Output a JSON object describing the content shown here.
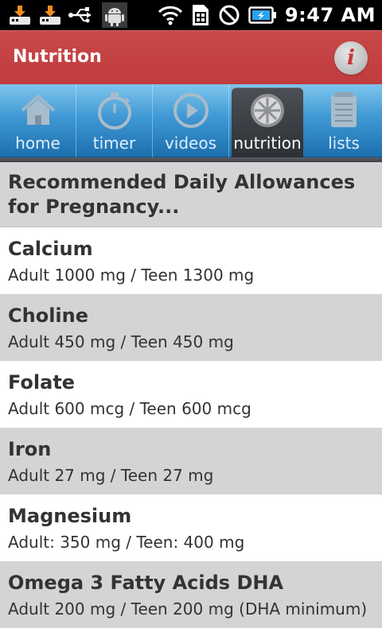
{
  "status_bar": {
    "time": "9:47 AM",
    "icons": [
      "download-icon",
      "download-icon",
      "usb-icon",
      "android-debug-icon",
      "wifi-icon",
      "sim-card-icon",
      "no-signal-icon",
      "battery-charging-icon"
    ]
  },
  "title_bar": {
    "title": "Nutrition",
    "info_label": "i"
  },
  "tabs": [
    {
      "label": "home",
      "icon": "home-icon",
      "active": false
    },
    {
      "label": "timer",
      "icon": "stopwatch-icon",
      "active": false
    },
    {
      "label": "videos",
      "icon": "play-icon",
      "active": false
    },
    {
      "label": "nutrition",
      "icon": "orange-slice-icon",
      "active": true
    },
    {
      "label": "lists",
      "icon": "notepad-icon",
      "active": false
    }
  ],
  "list": {
    "header": "Recommended Daily Allowances for Pregnancy...",
    "items": [
      {
        "name": "Calcium",
        "detail": "Adult 1000 mg / Teen 1300 mg"
      },
      {
        "name": "Choline",
        "detail": "Adult 450 mg / Teen 450 mg"
      },
      {
        "name": "Folate",
        "detail": "Adult 600 mcg / Teen 600 mcg"
      },
      {
        "name": "Iron",
        "detail": "Adult 27 mg / Teen 27 mg"
      },
      {
        "name": "Magnesium",
        "detail": "Adult: 350 mg / Teen: 400 mg"
      },
      {
        "name": "Omega 3 Fatty Acids DHA",
        "detail": "Adult 200 mg / Teen 200 mg (DHA minimum)"
      }
    ]
  },
  "colors": {
    "title_bar": "#c3393b",
    "tab_bar": "#3f98d4",
    "active_tab": "#3a3d42",
    "row_alt": "#d5d3d6",
    "text": "#333333"
  }
}
